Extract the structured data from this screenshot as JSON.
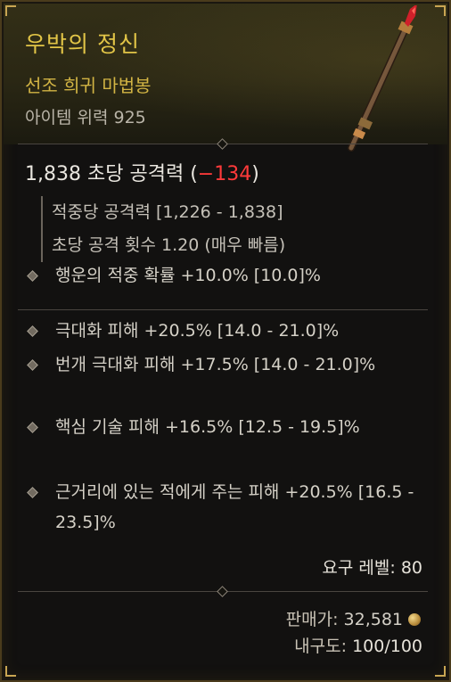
{
  "item": {
    "name": "우박의 정신",
    "type": "선조 희귀 마법봉",
    "power": "아이템 위력 925"
  },
  "damage": {
    "dps": "1,838",
    "dps_label": "초당 공격력",
    "dps_change": "−134",
    "damage_per_hit": "적중당 공격력 [1,226 - 1,838]",
    "attack_speed": "초당 공격 횟수 1.20 (매우 빠름)"
  },
  "implicit": "행운의 적중 확률 +10.0% [10.0]%",
  "affixes": [
    "극대화 피해 +20.5% [14.0 - 21.0]%",
    "번개 극대화 피해 +17.5% [14.0 - 21.0]%",
    "핵심 기술 피해 +16.5% [12.5 - 19.5]%",
    "근거리에 있는 적에게 주는 피해 +20.5% [16.5 - 23.5]%"
  ],
  "requirements": {
    "label": "요구 레벨:",
    "value": "80"
  },
  "sell": {
    "label": "판매가:",
    "value": "32,581",
    "icon": "gold-coin-icon"
  },
  "durability": {
    "label": "내구도:",
    "value": "100/100"
  },
  "colors": {
    "title": "#e2c547",
    "negative": "#ff3a3a",
    "frame": "#4a3b1c"
  }
}
